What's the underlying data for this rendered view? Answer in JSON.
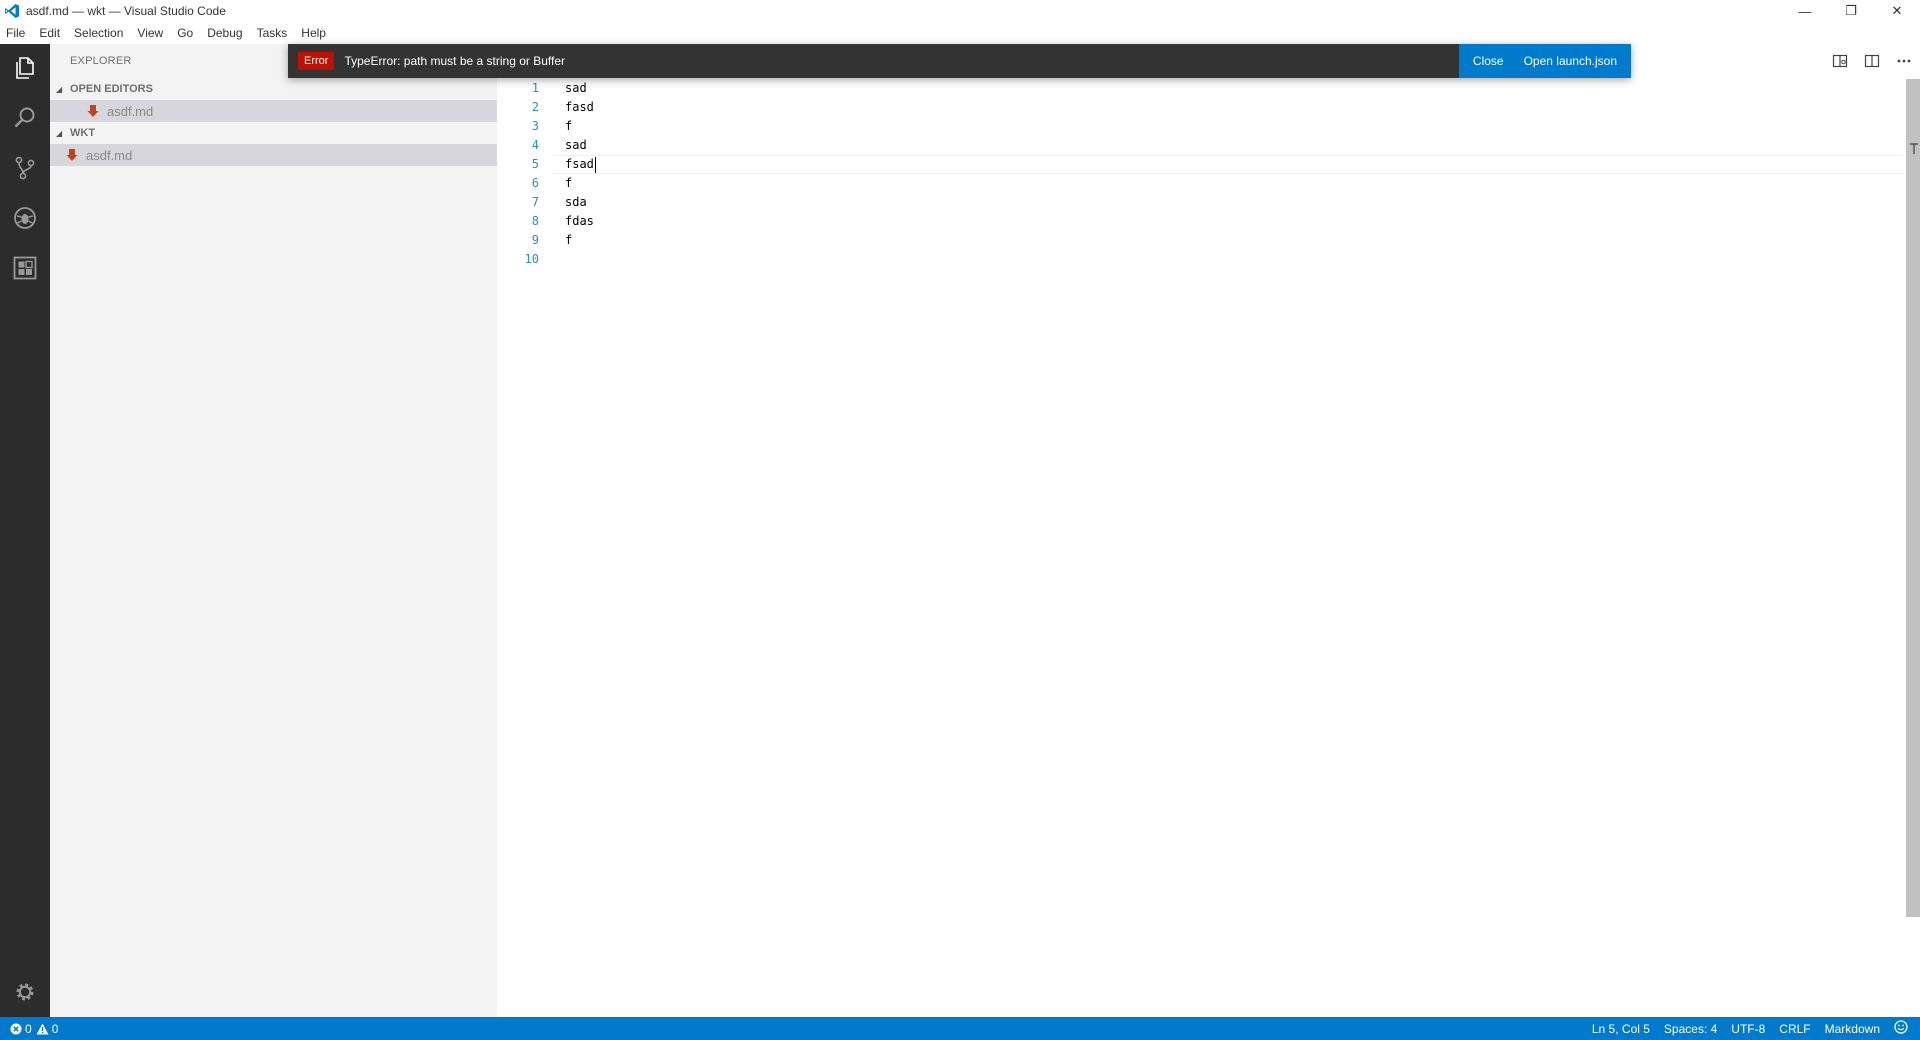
{
  "window": {
    "title": "asdf.md — wkt — Visual Studio Code",
    "minimize_glyph": "—",
    "restore_glyph": "❐",
    "close_glyph": "✕"
  },
  "menu": [
    "File",
    "Edit",
    "Selection",
    "View",
    "Go",
    "Debug",
    "Tasks",
    "Help"
  ],
  "activity_bar": {
    "icons": [
      "explorer-icon",
      "search-icon",
      "source-control-icon",
      "debug-icon",
      "extensions-icon"
    ],
    "bottom_icon": "settings-gear-icon"
  },
  "sidebar": {
    "title": "EXPLORER",
    "open_editors": {
      "header": "OPEN EDITORS",
      "files": [
        "asdf.md"
      ]
    },
    "folder": {
      "header": "WKT",
      "files": [
        "asdf.md"
      ]
    }
  },
  "notification": {
    "severity": "Error",
    "message": "TypeError: path must be a string or Buffer",
    "actions": [
      "Close",
      "Open launch.json"
    ]
  },
  "editor": {
    "lines": [
      "sad",
      "fasd",
      "f",
      "sad",
      "fsad",
      "f",
      "sda",
      "fdas",
      "f",
      ""
    ],
    "line_numbers": [
      "1",
      "2",
      "3",
      "4",
      "5",
      "6",
      "7",
      "8",
      "9",
      "10"
    ],
    "cursor_line": 5
  },
  "statusbar": {
    "errors": "0",
    "warnings": "0",
    "position": "Ln 5, Col 5",
    "spaces": "Spaces: 4",
    "encoding": "UTF-8",
    "eol": "CRLF",
    "language": "Markdown",
    "feedback_icon": "smiley-icon"
  },
  "colors": {
    "activity_bar": "#2c2c2c",
    "sidebar": "#f3f3f3",
    "statusbar": "#007acc",
    "notification_bg": "#333333",
    "error_badge": "#be1100",
    "line_number": "#2b91af",
    "selected_row": "#d6d6dc"
  }
}
